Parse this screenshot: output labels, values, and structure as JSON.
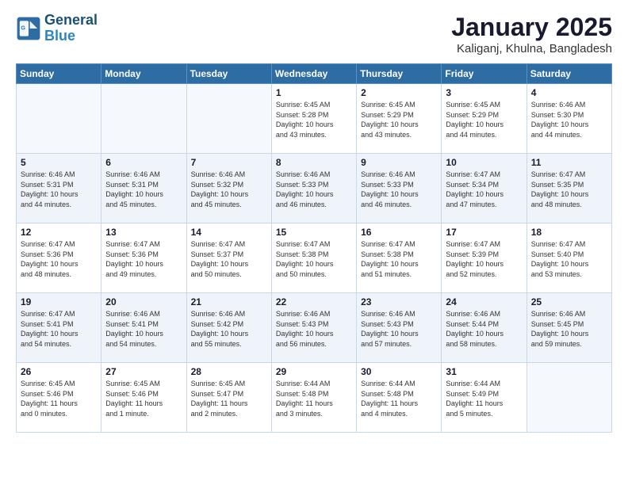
{
  "header": {
    "logo_line1": "General",
    "logo_line2": "Blue",
    "title": "January 2025",
    "subtitle": "Kaliganj, Khulna, Bangladesh"
  },
  "columns": [
    "Sunday",
    "Monday",
    "Tuesday",
    "Wednesday",
    "Thursday",
    "Friday",
    "Saturday"
  ],
  "weeks": [
    [
      {
        "day": "",
        "info": ""
      },
      {
        "day": "",
        "info": ""
      },
      {
        "day": "",
        "info": ""
      },
      {
        "day": "1",
        "info": "Sunrise: 6:45 AM\nSunset: 5:28 PM\nDaylight: 10 hours\nand 43 minutes."
      },
      {
        "day": "2",
        "info": "Sunrise: 6:45 AM\nSunset: 5:29 PM\nDaylight: 10 hours\nand 43 minutes."
      },
      {
        "day": "3",
        "info": "Sunrise: 6:45 AM\nSunset: 5:29 PM\nDaylight: 10 hours\nand 44 minutes."
      },
      {
        "day": "4",
        "info": "Sunrise: 6:46 AM\nSunset: 5:30 PM\nDaylight: 10 hours\nand 44 minutes."
      }
    ],
    [
      {
        "day": "5",
        "info": "Sunrise: 6:46 AM\nSunset: 5:31 PM\nDaylight: 10 hours\nand 44 minutes."
      },
      {
        "day": "6",
        "info": "Sunrise: 6:46 AM\nSunset: 5:31 PM\nDaylight: 10 hours\nand 45 minutes."
      },
      {
        "day": "7",
        "info": "Sunrise: 6:46 AM\nSunset: 5:32 PM\nDaylight: 10 hours\nand 45 minutes."
      },
      {
        "day": "8",
        "info": "Sunrise: 6:46 AM\nSunset: 5:33 PM\nDaylight: 10 hours\nand 46 minutes."
      },
      {
        "day": "9",
        "info": "Sunrise: 6:46 AM\nSunset: 5:33 PM\nDaylight: 10 hours\nand 46 minutes."
      },
      {
        "day": "10",
        "info": "Sunrise: 6:47 AM\nSunset: 5:34 PM\nDaylight: 10 hours\nand 47 minutes."
      },
      {
        "day": "11",
        "info": "Sunrise: 6:47 AM\nSunset: 5:35 PM\nDaylight: 10 hours\nand 48 minutes."
      }
    ],
    [
      {
        "day": "12",
        "info": "Sunrise: 6:47 AM\nSunset: 5:36 PM\nDaylight: 10 hours\nand 48 minutes."
      },
      {
        "day": "13",
        "info": "Sunrise: 6:47 AM\nSunset: 5:36 PM\nDaylight: 10 hours\nand 49 minutes."
      },
      {
        "day": "14",
        "info": "Sunrise: 6:47 AM\nSunset: 5:37 PM\nDaylight: 10 hours\nand 50 minutes."
      },
      {
        "day": "15",
        "info": "Sunrise: 6:47 AM\nSunset: 5:38 PM\nDaylight: 10 hours\nand 50 minutes."
      },
      {
        "day": "16",
        "info": "Sunrise: 6:47 AM\nSunset: 5:38 PM\nDaylight: 10 hours\nand 51 minutes."
      },
      {
        "day": "17",
        "info": "Sunrise: 6:47 AM\nSunset: 5:39 PM\nDaylight: 10 hours\nand 52 minutes."
      },
      {
        "day": "18",
        "info": "Sunrise: 6:47 AM\nSunset: 5:40 PM\nDaylight: 10 hours\nand 53 minutes."
      }
    ],
    [
      {
        "day": "19",
        "info": "Sunrise: 6:47 AM\nSunset: 5:41 PM\nDaylight: 10 hours\nand 54 minutes."
      },
      {
        "day": "20",
        "info": "Sunrise: 6:46 AM\nSunset: 5:41 PM\nDaylight: 10 hours\nand 54 minutes."
      },
      {
        "day": "21",
        "info": "Sunrise: 6:46 AM\nSunset: 5:42 PM\nDaylight: 10 hours\nand 55 minutes."
      },
      {
        "day": "22",
        "info": "Sunrise: 6:46 AM\nSunset: 5:43 PM\nDaylight: 10 hours\nand 56 minutes."
      },
      {
        "day": "23",
        "info": "Sunrise: 6:46 AM\nSunset: 5:43 PM\nDaylight: 10 hours\nand 57 minutes."
      },
      {
        "day": "24",
        "info": "Sunrise: 6:46 AM\nSunset: 5:44 PM\nDaylight: 10 hours\nand 58 minutes."
      },
      {
        "day": "25",
        "info": "Sunrise: 6:46 AM\nSunset: 5:45 PM\nDaylight: 10 hours\nand 59 minutes."
      }
    ],
    [
      {
        "day": "26",
        "info": "Sunrise: 6:45 AM\nSunset: 5:46 PM\nDaylight: 11 hours\nand 0 minutes."
      },
      {
        "day": "27",
        "info": "Sunrise: 6:45 AM\nSunset: 5:46 PM\nDaylight: 11 hours\nand 1 minute."
      },
      {
        "day": "28",
        "info": "Sunrise: 6:45 AM\nSunset: 5:47 PM\nDaylight: 11 hours\nand 2 minutes."
      },
      {
        "day": "29",
        "info": "Sunrise: 6:44 AM\nSunset: 5:48 PM\nDaylight: 11 hours\nand 3 minutes."
      },
      {
        "day": "30",
        "info": "Sunrise: 6:44 AM\nSunset: 5:48 PM\nDaylight: 11 hours\nand 4 minutes."
      },
      {
        "day": "31",
        "info": "Sunrise: 6:44 AM\nSunset: 5:49 PM\nDaylight: 11 hours\nand 5 minutes."
      },
      {
        "day": "",
        "info": ""
      }
    ]
  ]
}
